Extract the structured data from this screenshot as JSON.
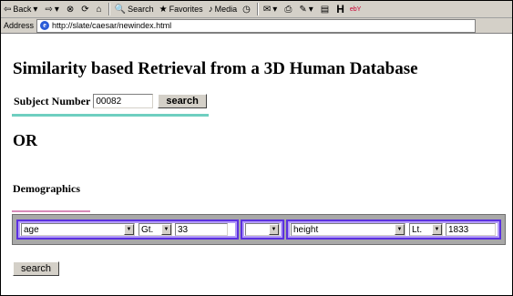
{
  "toolbar": {
    "back": "Back",
    "search": "Search",
    "favorites": "Favorites",
    "media": "Media"
  },
  "address": {
    "label": "Address",
    "url": "http://slate/caesar/newindex.html"
  },
  "page": {
    "title": "Similarity based Retrieval from a 3D Human Database",
    "subject_label": "Subject Number",
    "subject_value": "00082",
    "search_label": "search",
    "or_label": "OR",
    "demographics_label": "Demographics",
    "bottom_search_label": "search"
  },
  "demographics_row": {
    "field1": "age",
    "op1": "Gt.",
    "value1": "33",
    "connector": "",
    "field2": "height",
    "op2": "Lt.",
    "value2": "1833"
  },
  "colors": {
    "cell_border": "#5b30e0",
    "teal_bar": "#6fcfc0",
    "pink_bar": "#d88ab8"
  }
}
